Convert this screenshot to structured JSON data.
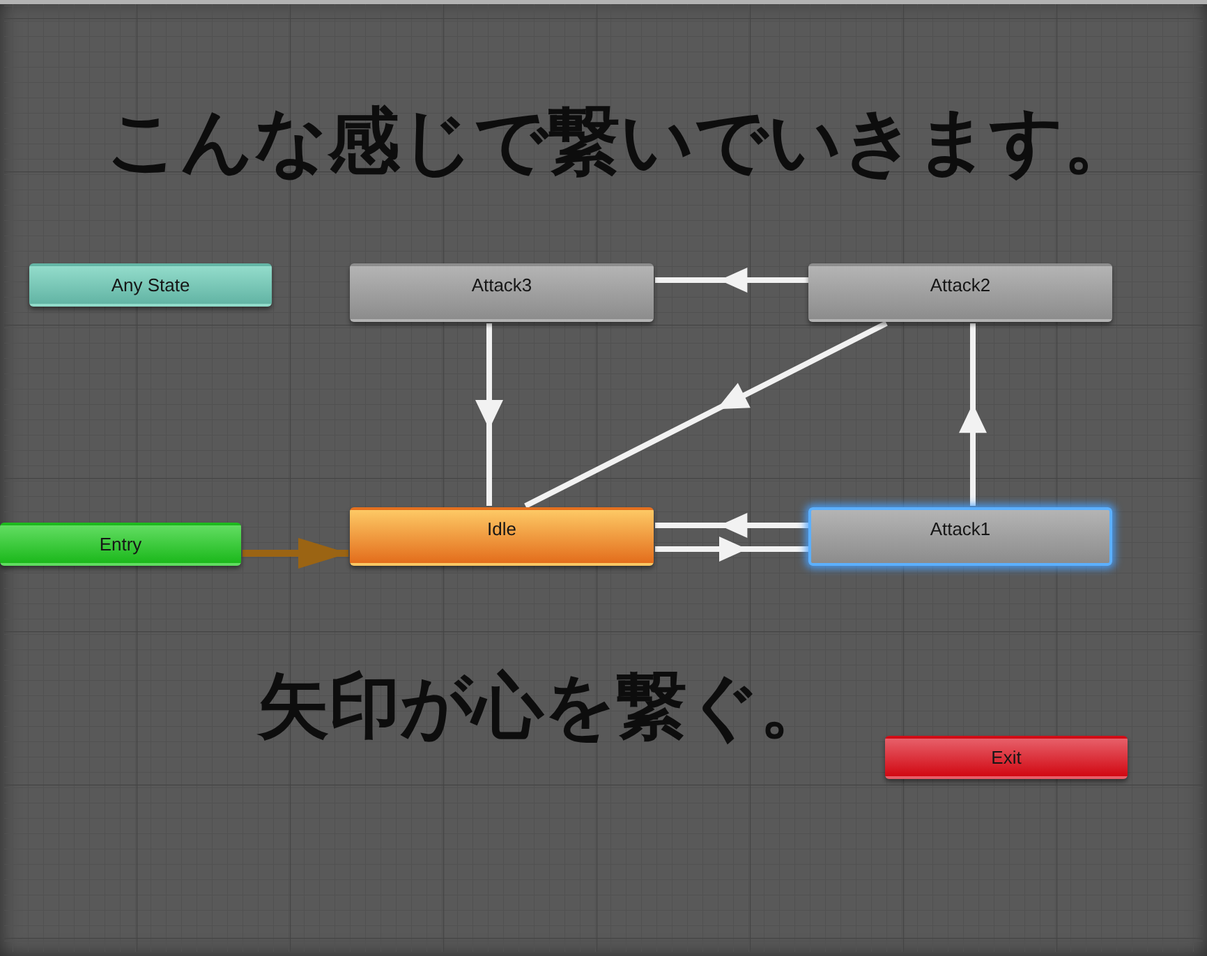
{
  "captions": [
    {
      "text": "こんな感じで繋いでいきます。"
    },
    {
      "text": "矢印が心を繋ぐ。"
    }
  ],
  "states": [
    {
      "label": "Any State",
      "kind": "any",
      "selected": false
    },
    {
      "label": "Attack3",
      "kind": "state",
      "selected": false
    },
    {
      "label": "Attack2",
      "kind": "state",
      "selected": false
    },
    {
      "label": "Entry",
      "kind": "entry",
      "selected": false
    },
    {
      "label": "Idle",
      "kind": "default",
      "selected": false
    },
    {
      "label": "Attack1",
      "kind": "state",
      "selected": true
    },
    {
      "label": "Exit",
      "kind": "exit",
      "selected": false
    }
  ]
}
